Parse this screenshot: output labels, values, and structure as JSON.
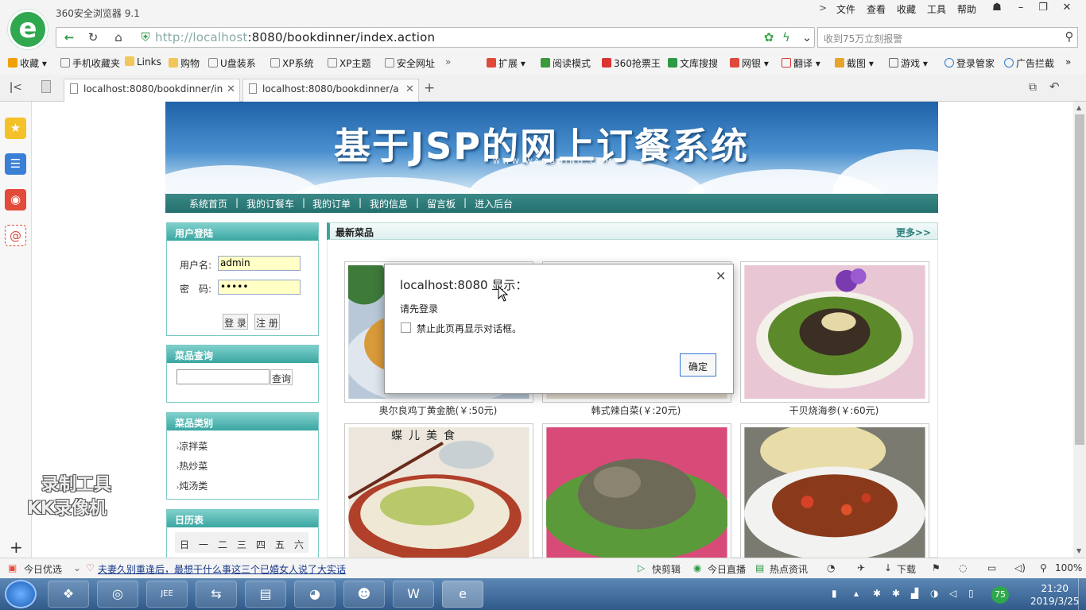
{
  "browser": {
    "app_title": "360安全浏览器 9.1",
    "menus": [
      "文件",
      "查看",
      "收藏",
      "工具",
      "帮助"
    ],
    "url_host": "http://localhost",
    "url_rest": ":8080/bookdinner/index.action",
    "search_placeholder": "收到75万立刻报警",
    "bookmarks": [
      "收藏",
      "手机收藏夹",
      "Links",
      "购物",
      "U盘装系",
      "XP系统",
      "XP主题",
      "安全网址"
    ],
    "toolbar_items": [
      "扩展",
      "阅读模式",
      "360抢票王",
      "文库搜搜",
      "网银",
      "翻译",
      "截图",
      "游戏",
      "登录管家",
      "广告拦截"
    ],
    "tabs": [
      {
        "label": "localhost:8080/bookdinner/in"
      },
      {
        "label": "localhost:8080/bookdinner/a"
      }
    ]
  },
  "site": {
    "banner_title": "基于JSP的网上订餐系统",
    "banner_sub": "WWW.WANGDING.COM",
    "nav": [
      "系统首页",
      "我的订餐车",
      "我的订单",
      "我的信息",
      "留言板",
      "进入后台"
    ]
  },
  "login": {
    "header": "用户登陆",
    "username_label": "用户名:",
    "username_value": "admin",
    "password_label": "密　码:",
    "password_value": "•••••",
    "login_button": "登 录",
    "register_button": "注 册"
  },
  "dish_search": {
    "header": "菜品查询",
    "button": "查询"
  },
  "categories": {
    "header": "菜品类别",
    "items": [
      "凉拌菜",
      "热炒菜",
      "炖汤类"
    ]
  },
  "calendar": {
    "header": "日历表",
    "days": [
      "日",
      "一",
      "二",
      "三",
      "四",
      "五",
      "六"
    ]
  },
  "main": {
    "title": "最新菜品",
    "more": "更多>>",
    "dishes": [
      {
        "name": "奥尔良鸡丁黄金脆(￥:50元)"
      },
      {
        "name": "韩式辣白菜(￥:20元)"
      },
      {
        "name": "干贝烧海参(￥:60元)"
      },
      {
        "name": ""
      },
      {
        "name": ""
      },
      {
        "name": ""
      }
    ],
    "image_text_1": "蝶儿美食"
  },
  "dialog": {
    "title": "localhost:8080 显示：",
    "message": "请先登录",
    "checkbox_label": "禁止此页再显示对话框。",
    "ok_button": "确定"
  },
  "watermark": {
    "line1": "录制工具",
    "line2": "KK录像机"
  },
  "statusbar": {
    "news_label": "今日优选",
    "headline": "夫妻久别重逢后，最想干什么事这三个已婚女人说了大实话",
    "items": [
      "快剪辑",
      "今日直播",
      "热点资讯",
      "下载"
    ],
    "zoom": "100%"
  },
  "taskbar": {
    "time": "21:20",
    "date": "2019/3/25",
    "badge": "75"
  },
  "colors": {
    "teal_header": "#3aa6a1",
    "nav_bar": "#24706e",
    "banner_sky": "#1f62a8"
  }
}
